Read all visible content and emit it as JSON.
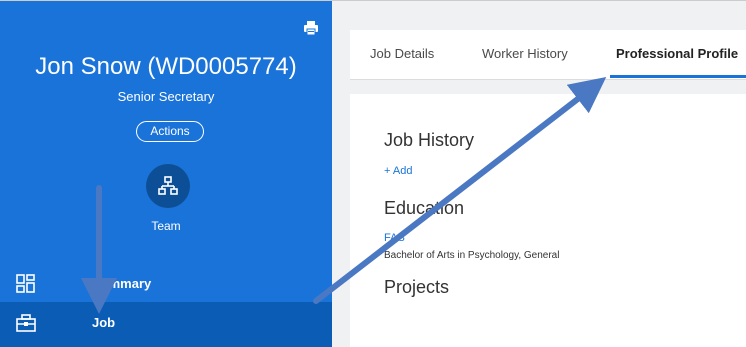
{
  "profile": {
    "name": "Jon Snow (WD0005774)",
    "title": "Senior Secretary",
    "actions_label": "Actions",
    "team_label": "Team"
  },
  "nav": {
    "summary_label": "Summary",
    "job_label": "Job"
  },
  "tabs": {
    "job_details": "Job Details",
    "worker_history": "Worker History",
    "professional_profile": "Professional Profile"
  },
  "content": {
    "job_history_heading": "Job History",
    "add_label": "+ Add",
    "education_heading": "Education",
    "education_school": "FAS",
    "education_degree": "Bachelor of Arts in Psychology, General",
    "projects_heading": "Projects"
  },
  "colors": {
    "panel_blue": "#1a73d9",
    "active_nav": "#0b5cb5",
    "arrow": "#4a78c2"
  },
  "icons": {
    "print": "print-icon",
    "team": "org-chart-icon",
    "summary": "dashboard-grid-icon",
    "job": "briefcase-icon"
  }
}
